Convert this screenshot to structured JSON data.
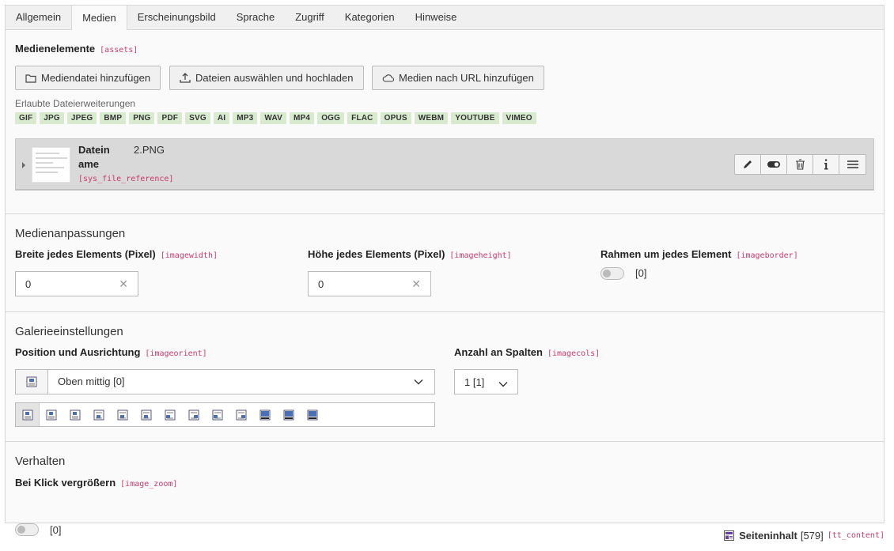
{
  "tabs": [
    "Allgemein",
    "Medien",
    "Erscheinungsbild",
    "Sprache",
    "Zugriff",
    "Kategorien",
    "Hinweise"
  ],
  "media": {
    "label": "Medienelemente",
    "key": "[assets]",
    "buttons": {
      "add_media": "Mediendatei hinzufügen",
      "upload": "Dateien auswählen und hochladen",
      "add_url": "Medien nach URL hinzufügen"
    },
    "allowed_label": "Erlaubte Dateierweiterungen",
    "extensions": [
      "GIF",
      "JPG",
      "JPEG",
      "BMP",
      "PNG",
      "PDF",
      "SVG",
      "AI",
      "MP3",
      "WAV",
      "MP4",
      "OGG",
      "FLAC",
      "OPUS",
      "WEBM",
      "YOUTUBE",
      "VIMEO"
    ],
    "file": {
      "label_line1": "Datein",
      "label_line2": "ame",
      "value": "2.PNG",
      "key": "[sys_file_reference]"
    }
  },
  "adjust": {
    "title": "Medienanpassungen",
    "width": {
      "label": "Breite jedes Elements (Pixel)",
      "key": "[imagewidth]",
      "value": "0"
    },
    "height": {
      "label": "Höhe jedes Elements (Pixel)",
      "key": "[imageheight]",
      "value": "0"
    },
    "border": {
      "label": "Rahmen um jedes Element",
      "key": "[imageborder]",
      "value": "[0]"
    }
  },
  "gallery": {
    "title": "Galerieeinstellungen",
    "position": {
      "label": "Position und Ausrichtung",
      "key": "[imageorient]",
      "value": "Oben mittig [0]"
    },
    "columns": {
      "label": "Anzahl an Spalten",
      "key": "[imagecols]",
      "value": "1 [1]"
    }
  },
  "behaviour": {
    "title": "Verhalten",
    "zoom": {
      "label": "Bei Klick vergrößern",
      "key": "[image_zoom]",
      "value": "[0]"
    }
  },
  "footer": {
    "record": "Seiteninhalt",
    "uid": "[579]",
    "table": "[tt_content]"
  }
}
